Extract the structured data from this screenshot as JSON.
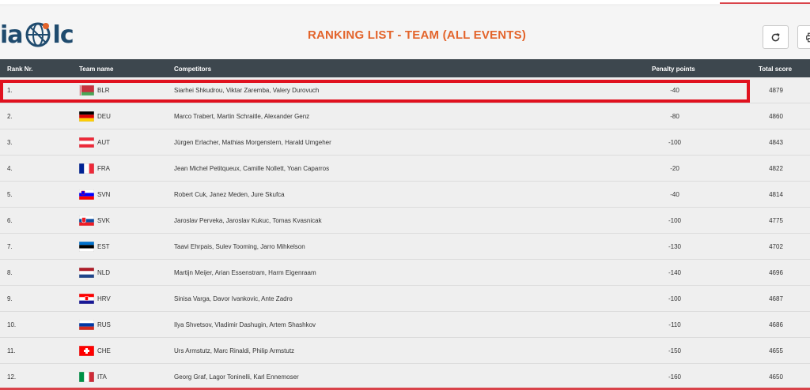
{
  "header": {
    "logo_prefix": "ia",
    "logo_suffix": "lc",
    "title": "RANKING LIST - TEAM (ALL EVENTS)"
  },
  "columns": {
    "rank": "Rank Nr.",
    "team": "Team name",
    "competitors": "Competitors",
    "penalty": "Penalty points",
    "total": "Total score"
  },
  "rows": [
    {
      "rank": "1.",
      "code": "BLR",
      "flag": "blr",
      "competitors": "Siarhei Shkudrou, Viktar Zaremba, Valery Durovuch",
      "penalty": "-40",
      "total": "4879",
      "highlighted": true
    },
    {
      "rank": "2.",
      "code": "DEU",
      "flag": "deu",
      "competitors": "Marco Trabert, Martin Schraitle, Alexander Genz",
      "penalty": "-80",
      "total": "4860"
    },
    {
      "rank": "3.",
      "code": "AUT",
      "flag": "aut",
      "competitors": "Jürgen Erlacher, Mathias Morgenstern, Harald Umgeher",
      "penalty": "-100",
      "total": "4843"
    },
    {
      "rank": "4.",
      "code": "FRA",
      "flag": "fra",
      "competitors": "Jean Michel Petitqueux, Camille Nollett, Yoan Caparros",
      "penalty": "-20",
      "total": "4822"
    },
    {
      "rank": "5.",
      "code": "SVN",
      "flag": "svn",
      "competitors": "Robert Cuk, Janez Meden, Jure Skufca",
      "penalty": "-40",
      "total": "4814"
    },
    {
      "rank": "6.",
      "code": "SVK",
      "flag": "svk",
      "competitors": "Jaroslav Perveka, Jaroslav Kukuc, Tomas Kvasnicak",
      "penalty": "-100",
      "total": "4775"
    },
    {
      "rank": "7.",
      "code": "EST",
      "flag": "est",
      "competitors": "Taavi Ehrpais, Sulev Tooming, Jarro Mihkelson",
      "penalty": "-130",
      "total": "4702"
    },
    {
      "rank": "8.",
      "code": "NLD",
      "flag": "nld",
      "competitors": "Martijn Meijer, Arian Essenstram, Harm Eigenraam",
      "penalty": "-140",
      "total": "4696"
    },
    {
      "rank": "9.",
      "code": "HRV",
      "flag": "hrv",
      "competitors": "Sinisa Varga, Davor Ivankovic, Ante Zadro",
      "penalty": "-100",
      "total": "4687"
    },
    {
      "rank": "10.",
      "code": "RUS",
      "flag": "rus",
      "competitors": "Ilya Shvetsov, Vladimir Dashugin, Artem Shashkov",
      "penalty": "-110",
      "total": "4686"
    },
    {
      "rank": "11.",
      "code": "CHE",
      "flag": "che",
      "competitors": "Urs Armstutz, Marc Rinaldi, Philip Armstutz",
      "penalty": "-150",
      "total": "4655"
    },
    {
      "rank": "12.",
      "code": "ITA",
      "flag": "ita",
      "competitors": "Georg Graf, Lagor Toninelli, Karl Ennemoser",
      "penalty": "-160",
      "total": "4650"
    }
  ],
  "icons": {
    "refresh": "refresh-icon",
    "print": "print-icon",
    "logo": "globe-icon"
  },
  "colors": {
    "title": "#e3642b",
    "header_bg": "#3d474e",
    "highlight": "#e0121f"
  }
}
